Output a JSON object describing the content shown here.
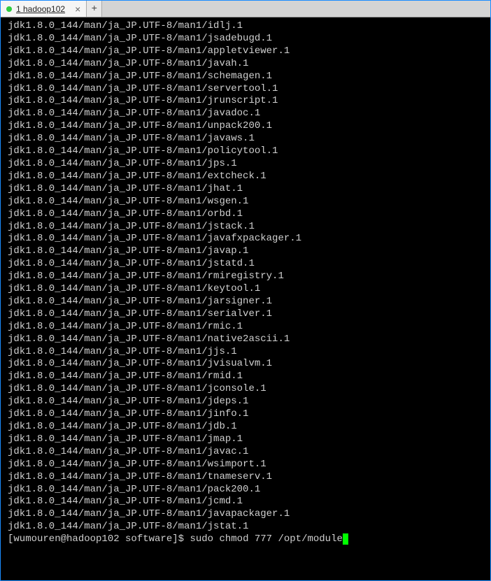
{
  "tabs": {
    "active": {
      "indicator_color": "#2ecc40",
      "label": "1 hadoop102"
    }
  },
  "terminal": {
    "lines": [
      "jdk1.8.0_144/man/ja_JP.UTF-8/man1/idlj.1",
      "jdk1.8.0_144/man/ja_JP.UTF-8/man1/jsadebugd.1",
      "jdk1.8.0_144/man/ja_JP.UTF-8/man1/appletviewer.1",
      "jdk1.8.0_144/man/ja_JP.UTF-8/man1/javah.1",
      "jdk1.8.0_144/man/ja_JP.UTF-8/man1/schemagen.1",
      "jdk1.8.0_144/man/ja_JP.UTF-8/man1/servertool.1",
      "jdk1.8.0_144/man/ja_JP.UTF-8/man1/jrunscript.1",
      "jdk1.8.0_144/man/ja_JP.UTF-8/man1/javadoc.1",
      "jdk1.8.0_144/man/ja_JP.UTF-8/man1/unpack200.1",
      "jdk1.8.0_144/man/ja_JP.UTF-8/man1/javaws.1",
      "jdk1.8.0_144/man/ja_JP.UTF-8/man1/policytool.1",
      "jdk1.8.0_144/man/ja_JP.UTF-8/man1/jps.1",
      "jdk1.8.0_144/man/ja_JP.UTF-8/man1/extcheck.1",
      "jdk1.8.0_144/man/ja_JP.UTF-8/man1/jhat.1",
      "jdk1.8.0_144/man/ja_JP.UTF-8/man1/wsgen.1",
      "jdk1.8.0_144/man/ja_JP.UTF-8/man1/orbd.1",
      "jdk1.8.0_144/man/ja_JP.UTF-8/man1/jstack.1",
      "jdk1.8.0_144/man/ja_JP.UTF-8/man1/javafxpackager.1",
      "jdk1.8.0_144/man/ja_JP.UTF-8/man1/javap.1",
      "jdk1.8.0_144/man/ja_JP.UTF-8/man1/jstatd.1",
      "jdk1.8.0_144/man/ja_JP.UTF-8/man1/rmiregistry.1",
      "jdk1.8.0_144/man/ja_JP.UTF-8/man1/keytool.1",
      "jdk1.8.0_144/man/ja_JP.UTF-8/man1/jarsigner.1",
      "jdk1.8.0_144/man/ja_JP.UTF-8/man1/serialver.1",
      "jdk1.8.0_144/man/ja_JP.UTF-8/man1/rmic.1",
      "jdk1.8.0_144/man/ja_JP.UTF-8/man1/native2ascii.1",
      "jdk1.8.0_144/man/ja_JP.UTF-8/man1/jjs.1",
      "jdk1.8.0_144/man/ja_JP.UTF-8/man1/jvisualvm.1",
      "jdk1.8.0_144/man/ja_JP.UTF-8/man1/rmid.1",
      "jdk1.8.0_144/man/ja_JP.UTF-8/man1/jconsole.1",
      "jdk1.8.0_144/man/ja_JP.UTF-8/man1/jdeps.1",
      "jdk1.8.0_144/man/ja_JP.UTF-8/man1/jinfo.1",
      "jdk1.8.0_144/man/ja_JP.UTF-8/man1/jdb.1",
      "jdk1.8.0_144/man/ja_JP.UTF-8/man1/jmap.1",
      "jdk1.8.0_144/man/ja_JP.UTF-8/man1/javac.1",
      "jdk1.8.0_144/man/ja_JP.UTF-8/man1/wsimport.1",
      "jdk1.8.0_144/man/ja_JP.UTF-8/man1/tnameserv.1",
      "jdk1.8.0_144/man/ja_JP.UTF-8/man1/pack200.1",
      "jdk1.8.0_144/man/ja_JP.UTF-8/man1/jcmd.1",
      "jdk1.8.0_144/man/ja_JP.UTF-8/man1/javapackager.1",
      "jdk1.8.0_144/man/ja_JP.UTF-8/man1/jstat.1"
    ],
    "prompt": "[wumouren@hadoop102 software]$ ",
    "command": "sudo chmod 777 /opt/module"
  }
}
